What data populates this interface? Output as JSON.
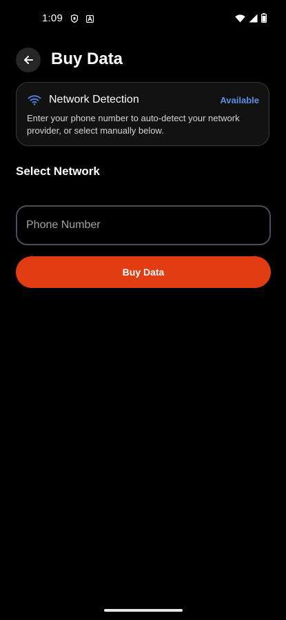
{
  "status_bar": {
    "time": "1:09",
    "left_icons": [
      "shield-icon",
      "a-notification-icon"
    ],
    "right_icons": [
      "wifi-icon",
      "signal-icon",
      "battery-icon"
    ]
  },
  "header": {
    "back_icon": "arrow-left-icon",
    "title": "Buy Data"
  },
  "detection_card": {
    "icon": "wifi-icon",
    "title": "Network Detection",
    "status": "Available",
    "description": "Enter your phone number to auto-detect your network provider, or select manually below."
  },
  "select_network": {
    "title": "Select Network"
  },
  "phone_input": {
    "placeholder": "Phone Number",
    "value": ""
  },
  "buy_button": {
    "label": "Buy Data"
  },
  "colors": {
    "background": "#000000",
    "accent": "#e23d12",
    "status_available": "#5b8fe6",
    "card_background": "#121212"
  }
}
